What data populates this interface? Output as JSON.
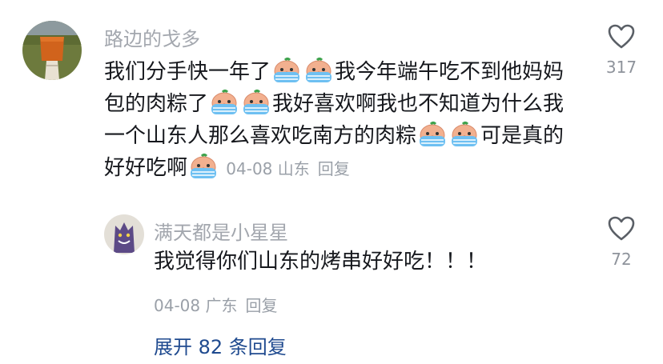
{
  "colors": {
    "author": "#a3a7ae",
    "text": "#16181d",
    "meta": "#9aa0a8",
    "link": "#1f4a8f"
  },
  "comment": {
    "author": "路边的戈多",
    "segments": {
      "s1": "我们分手快一年了",
      "s2": "我今年端午吃不到他妈妈包的肉粽了",
      "s3": "我好喜欢啊我也不知道为什么我一个山东人那么喜欢吃南方的肉粽",
      "s4": "可是真的好好吃啊"
    },
    "emoji_icon": "crying-face-emoji-icon",
    "date": "04-08",
    "location": "山东",
    "reply_label": "回复",
    "likes": "317"
  },
  "reply": {
    "author": "满天都是小星星",
    "text": "我觉得你们山东的烤串好好吃！！！",
    "date": "04-08",
    "location": "广东",
    "reply_label": "回复",
    "likes": "72"
  },
  "expand": {
    "label": "展开 82 条回复"
  }
}
